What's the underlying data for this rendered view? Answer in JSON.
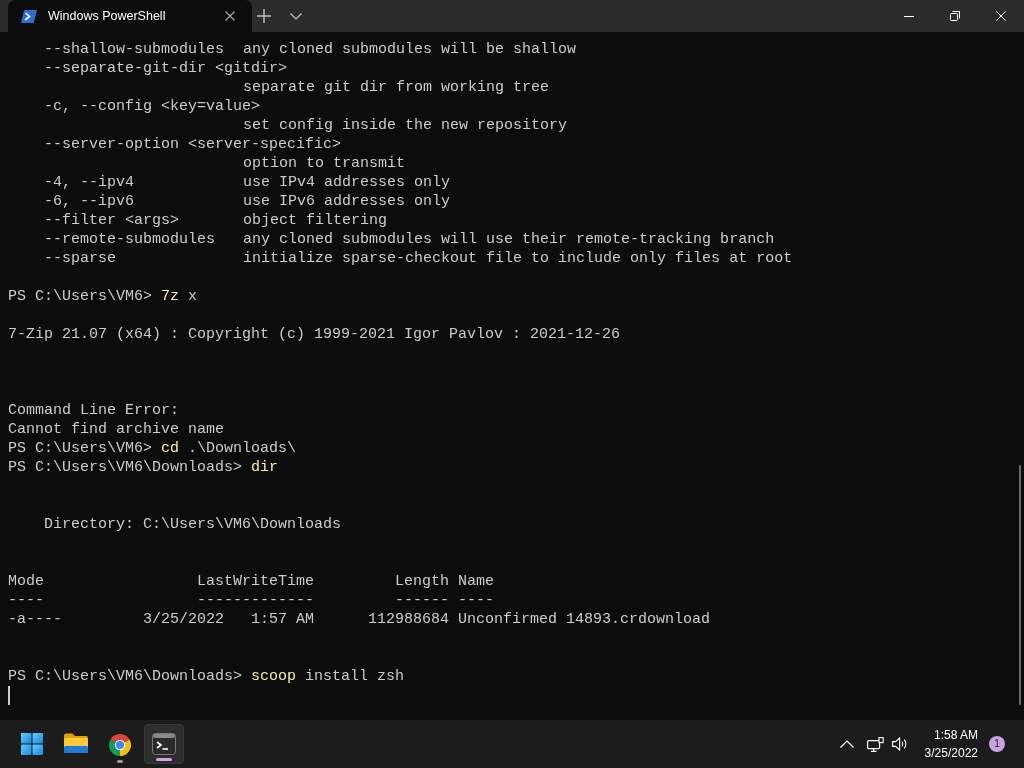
{
  "tabs": [
    {
      "title": "Windows PowerShell",
      "selected": true
    }
  ],
  "terminal": {
    "lines": [
      {
        "kind": "option",
        "option": "--shallow-submodules",
        "description": "any cloned submodules will be shallow"
      },
      {
        "kind": "option",
        "option": "--separate-git-dir <gitdir>",
        "description": "separate git dir from working tree"
      },
      {
        "kind": "option",
        "option": "-c, --config <key=value>",
        "description": "set config inside the new repository"
      },
      {
        "kind": "option",
        "option": "--server-option <server-specific>",
        "description": "option to transmit"
      },
      {
        "kind": "option",
        "option": "-4, --ipv4",
        "description": "use IPv4 addresses only"
      },
      {
        "kind": "option",
        "option": "-6, --ipv6",
        "description": "use IPv6 addresses only"
      },
      {
        "kind": "option",
        "option": "--filter <args>",
        "description": "object filtering"
      },
      {
        "kind": "option",
        "option": "--remote-submodules",
        "description": "any cloned submodules will use their remote-tracking branch"
      },
      {
        "kind": "option",
        "option": "--sparse",
        "description": "initialize sparse-checkout file to include only files at root"
      },
      {
        "kind": "blank"
      },
      {
        "kind": "prompt",
        "prompt": "PS C:\\Users\\VM6>",
        "command": "7z",
        "arguments": "x"
      },
      {
        "kind": "blank"
      },
      {
        "kind": "output",
        "text": "7-Zip 21.07 (x64) : Copyright (c) 1999-2021 Igor Pavlov : 2021-12-26"
      },
      {
        "kind": "blank"
      },
      {
        "kind": "blank"
      },
      {
        "kind": "blank"
      },
      {
        "kind": "output",
        "text": "Command Line Error:"
      },
      {
        "kind": "output",
        "text": "Cannot find archive name"
      },
      {
        "kind": "prompt",
        "prompt": "PS C:\\Users\\VM6>",
        "command": "cd",
        "arguments": ".\\Downloads\\"
      },
      {
        "kind": "prompt",
        "prompt": "PS C:\\Users\\VM6\\Downloads>",
        "command": "dir"
      },
      {
        "kind": "blank"
      },
      {
        "kind": "blank"
      },
      {
        "kind": "heading",
        "text": "Directory: C:\\Users\\VM6\\Downloads"
      },
      {
        "kind": "blank"
      },
      {
        "kind": "blank"
      },
      {
        "kind": "listing_header",
        "columns": [
          "Mode",
          "LastWriteTime",
          "Length",
          "Name"
        ]
      },
      {
        "kind": "listing_rule",
        "columns": [
          "----",
          "-------------",
          "------",
          "----"
        ]
      },
      {
        "kind": "listing_row",
        "mode": "-a----",
        "date": "3/25/2022",
        "time": "1:57 AM",
        "length": "112988684",
        "name": "Unconfirmed 14893.crdownload"
      },
      {
        "kind": "blank"
      },
      {
        "kind": "blank"
      },
      {
        "kind": "prompt",
        "prompt": "PS C:\\Users\\VM6\\Downloads>",
        "command": "scoop",
        "arguments": "install zsh"
      },
      {
        "kind": "cursor"
      }
    ]
  },
  "taskbar": {
    "apps": [
      {
        "kind": "file_explorer",
        "running": false,
        "selected": false
      },
      {
        "kind": "browser",
        "running": true,
        "selected": false
      },
      {
        "kind": "terminal",
        "running": true,
        "selected": true
      }
    ],
    "clock": {
      "time": "1:58 AM",
      "date": "3/25/2022"
    },
    "notification_count": "1"
  }
}
